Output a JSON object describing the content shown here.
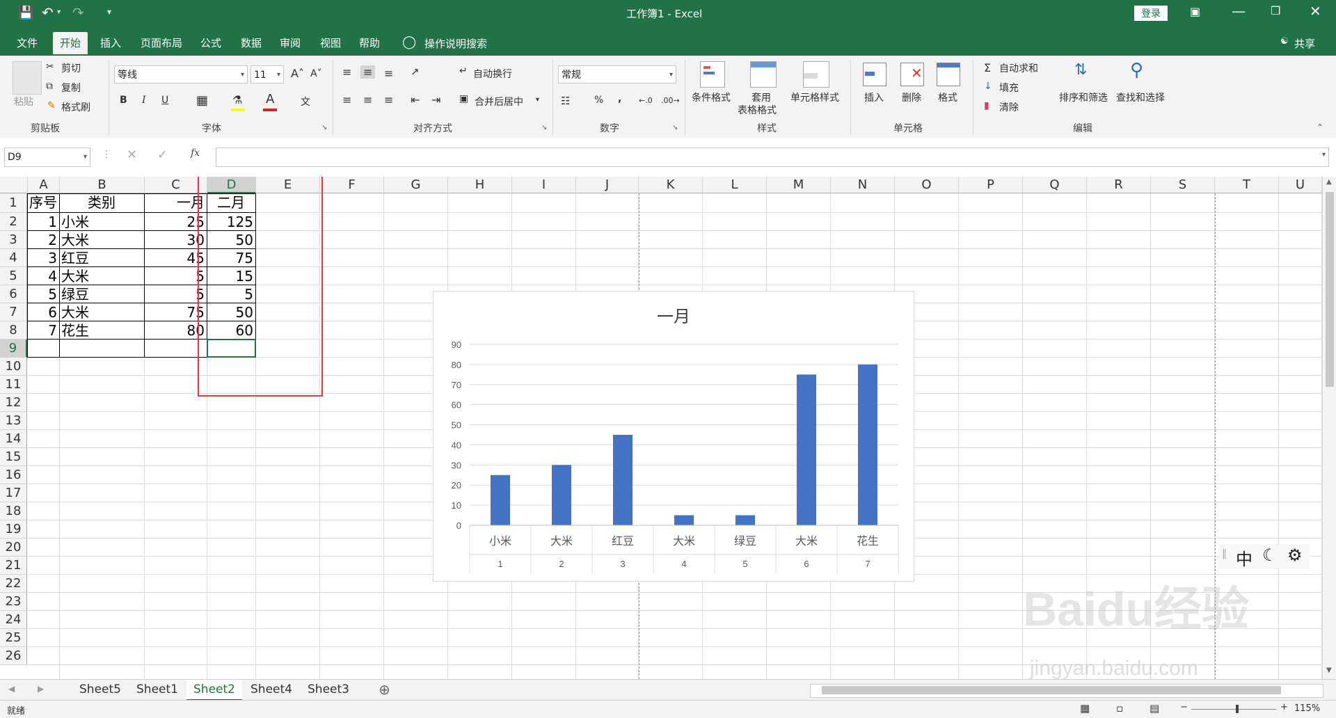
{
  "titlebar": {
    "title": "工作簿1  -  Excel",
    "login": "登录"
  },
  "tabs": [
    "文件",
    "开始",
    "插入",
    "页面布局",
    "公式",
    "数据",
    "审阅",
    "视图",
    "帮助"
  ],
  "active_tab": "开始",
  "tell_me": "操作说明搜索",
  "share": "共享",
  "ribbon": {
    "clipboard": {
      "paste": "粘贴",
      "cut": "剪切",
      "copy": "复制",
      "format_painter": "格式刷",
      "group": "剪贴板"
    },
    "font": {
      "font_name": "等线",
      "font_size": "11",
      "bold": "B",
      "italic": "I",
      "underline": "U",
      "group": "字体"
    },
    "alignment": {
      "wrap": "自动换行",
      "merge": "合并后居中",
      "group": "对齐方式"
    },
    "number": {
      "format": "常规",
      "percent": "%",
      "comma": ",",
      "group": "数字"
    },
    "styles": {
      "conditional": "条件格式",
      "table_line1": "套用",
      "table_line2": "表格格式",
      "cell_styles": "单元格样式",
      "group": "样式"
    },
    "cells": {
      "insert": "插入",
      "delete": "删除",
      "format": "格式",
      "group": "单元格"
    },
    "editing": {
      "autosum": "自动求和",
      "fill": "填充",
      "clear": "清除",
      "sort": "排序和筛选",
      "find": "查找和选择",
      "group": "编辑"
    }
  },
  "formula_bar": {
    "name_box": "D9",
    "fx": "fx",
    "content": ""
  },
  "columns": [
    "A",
    "B",
    "C",
    "D",
    "E",
    "F",
    "G",
    "H",
    "I",
    "J",
    "K",
    "L",
    "M",
    "N",
    "O",
    "P",
    "Q",
    "R",
    "S",
    "T",
    "U"
  ],
  "rows": [
    "1",
    "2",
    "3",
    "4",
    "5",
    "6",
    "7",
    "8",
    "9",
    "10",
    "11",
    "12",
    "13",
    "14",
    "15",
    "16",
    "17",
    "18",
    "19",
    "20",
    "21",
    "22",
    "23",
    "24",
    "25",
    "26"
  ],
  "table": {
    "headers": [
      "序号",
      "类别",
      "一月",
      "二月"
    ],
    "rows": [
      [
        "1",
        "小米",
        "25",
        "125"
      ],
      [
        "2",
        "大米",
        "30",
        "50"
      ],
      [
        "3",
        "红豆",
        "45",
        "75"
      ],
      [
        "4",
        "大米",
        "5",
        "15"
      ],
      [
        "5",
        "绿豆",
        "5",
        "5"
      ],
      [
        "6",
        "大米",
        "75",
        "50"
      ],
      [
        "7",
        "花生",
        "80",
        "60"
      ]
    ]
  },
  "chart_data": {
    "type": "bar",
    "title": "一月",
    "categories": [
      "小米",
      "大米",
      "红豆",
      "大米",
      "绿豆",
      "大米",
      "花生"
    ],
    "category_index": [
      "1",
      "2",
      "3",
      "4",
      "5",
      "6",
      "7"
    ],
    "values": [
      25,
      30,
      45,
      5,
      5,
      75,
      80
    ],
    "ylim": [
      0,
      90
    ],
    "yticks": [
      0,
      10,
      20,
      30,
      40,
      50,
      60,
      70,
      80,
      90
    ],
    "grid": true,
    "bar_color": "#4472C4"
  },
  "ime": {
    "mode": "中"
  },
  "sheets": [
    "Sheet5",
    "Sheet1",
    "Sheet2",
    "Sheet4",
    "Sheet3"
  ],
  "active_sheet": "Sheet2",
  "status": {
    "ready": "就绪",
    "zoom": "115%"
  },
  "watermark": {
    "brand": "Baidu经验",
    "url": "jingyan.baidu.com"
  },
  "colors": {
    "accent": "#217346",
    "highlight": "#e53935"
  }
}
